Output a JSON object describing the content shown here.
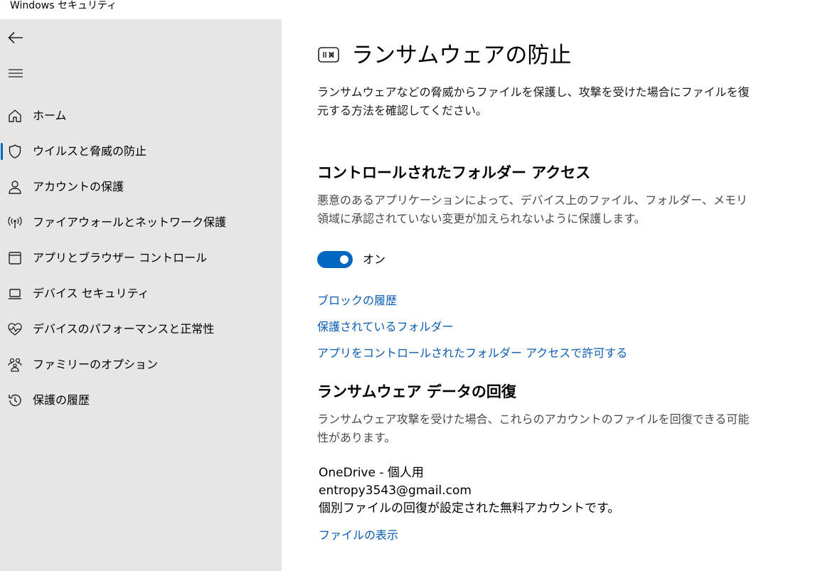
{
  "window": {
    "title": "Windows セキュリティ"
  },
  "sidebar": {
    "items": [
      {
        "label": "ホーム",
        "icon": "home-icon"
      },
      {
        "label": "ウイルスと脅威の防止",
        "icon": "shield-icon",
        "selected": true
      },
      {
        "label": "アカウントの保護",
        "icon": "person-icon"
      },
      {
        "label": "ファイアウォールとネットワーク保護",
        "icon": "antenna-icon"
      },
      {
        "label": "アプリとブラウザー コントロール",
        "icon": "app-window-icon"
      },
      {
        "label": "デバイス セキュリティ",
        "icon": "laptop-icon"
      },
      {
        "label": "デバイスのパフォーマンスと正常性",
        "icon": "heart-pulse-icon"
      },
      {
        "label": "ファミリーのオプション",
        "icon": "family-icon"
      },
      {
        "label": "保護の履歴",
        "icon": "history-icon"
      }
    ]
  },
  "main": {
    "title": "ランサムウェアの防止",
    "description": "ランサムウェアなどの脅威からファイルを保護し、攻撃を受けた場合にファイルを復元する方法を確認してください。",
    "cfa": {
      "title": "コントロールされたフォルダー アクセス",
      "description": "悪意のあるアプリケーションによって、デバイス上のファイル、フォルダー、メモリ領域に承認されていない変更が加えられないように保護します。",
      "toggle_label": "オン",
      "links": [
        "ブロックの履歴",
        "保護されているフォルダー",
        "アプリをコントロールされたフォルダー アクセスで許可する"
      ]
    },
    "recovery": {
      "title": "ランサムウェア データの回復",
      "description": "ランサムウェア攻撃を受けた場合、これらのアカウントのファイルを回復できる可能性があります。",
      "account_name": "OneDrive - 個人用",
      "account_email": "entropy3543@gmail.com",
      "account_note": "個別ファイルの回復が設定された無料アカウントです。",
      "link": "ファイルの表示"
    }
  },
  "colors": {
    "accent": "#0067c0",
    "link": "#0a5bb5",
    "sidebar_bg": "#e6e6e6"
  }
}
